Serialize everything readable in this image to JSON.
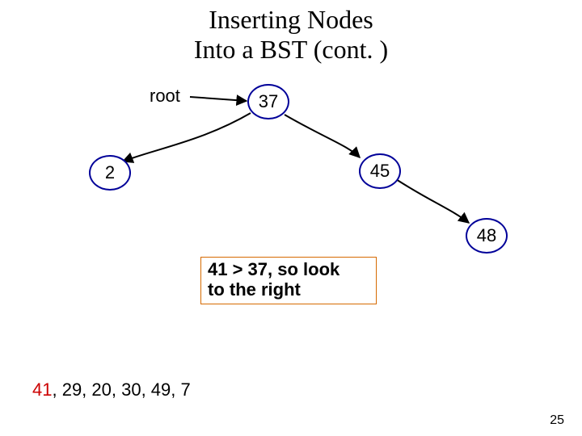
{
  "title_line1": "Inserting Nodes",
  "title_line2": "Into a BST (cont. )",
  "root_label": "root",
  "nodes": {
    "n37": "37",
    "n2": "2",
    "n45": "45",
    "n48": "48"
  },
  "note_line1": "41 > 37, so look",
  "note_line2": "to the right",
  "sequence_highlight": "41",
  "sequence_rest": ", 29, 20, 30, 49, 7",
  "page_number": "25"
}
